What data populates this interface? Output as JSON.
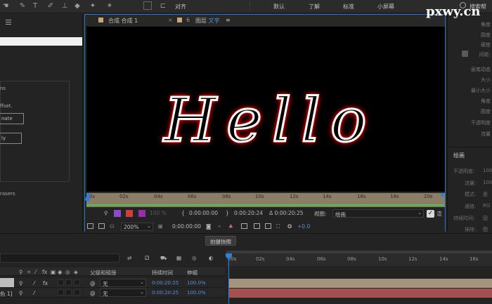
{
  "toolbar": {
    "snap_label": "对齐",
    "workspaces": [
      "默认",
      "了解",
      "标准",
      "小屏幕"
    ],
    "search_label": "搜索帮"
  },
  "watermark": "pxwy.cn",
  "left_panel": {
    "lines": [
      "ns",
      "ffset.",
      "nate",
      "ly",
      "rasers"
    ]
  },
  "composition": {
    "tab1": "合成 合成 1",
    "tab2_prefix": "图层",
    "tab2_name": "文字",
    "viewer_text": "Hello",
    "ruler_ticks": [
      "0s",
      "02s",
      "04s",
      "06s",
      "08s",
      "10s",
      "12s",
      "14s",
      "16s",
      "18s",
      "20s"
    ],
    "controls": {
      "zoom_pct": "100 %",
      "time_start": "0:00:00:00",
      "time_end": "0:00:20:24",
      "duration": "Δ 0:00:20:25",
      "view_label": "视图:",
      "view_value": "绘画",
      "render_label": "渲",
      "zoom": "200%",
      "timecode": "0:00:00:00",
      "exposure": "+0.0"
    }
  },
  "right_panel": {
    "labels_top": [
      "角度",
      "圆度",
      "硬度",
      "间距:",
      "画笔动态",
      "大小",
      "最小大小",
      "角度",
      "圆度",
      "不透明度",
      "流量"
    ],
    "section": "绘画",
    "rows": [
      {
        "label": "不透明度:",
        "value": "100"
      },
      {
        "label": "流量:",
        "value": "100"
      },
      {
        "label": "模式:",
        "value": "是"
      },
      {
        "label": "通道:",
        "value": "RG"
      },
      {
        "label": "持续时间:",
        "value": "固"
      },
      {
        "label": "抹除:",
        "value": "图"
      }
    ]
  },
  "timeline": {
    "snapshot_label": "拍摄快照",
    "headers": {
      "parent": "父级和链接",
      "duration": "持续时间",
      "stretch": "伸缩"
    },
    "rows": [
      {
        "name": "",
        "parent": "无",
        "duration": "0:00:20:25",
        "stretch": "100.0%"
      },
      {
        "name": "色 1]",
        "parent": "无",
        "duration": "0:00:20:25",
        "stretch": "100.0%"
      }
    ],
    "ruler_ticks": [
      "00s",
      "02s",
      "04s",
      "06s",
      "08s",
      "10s",
      "12s",
      "14s",
      "16s"
    ]
  }
}
